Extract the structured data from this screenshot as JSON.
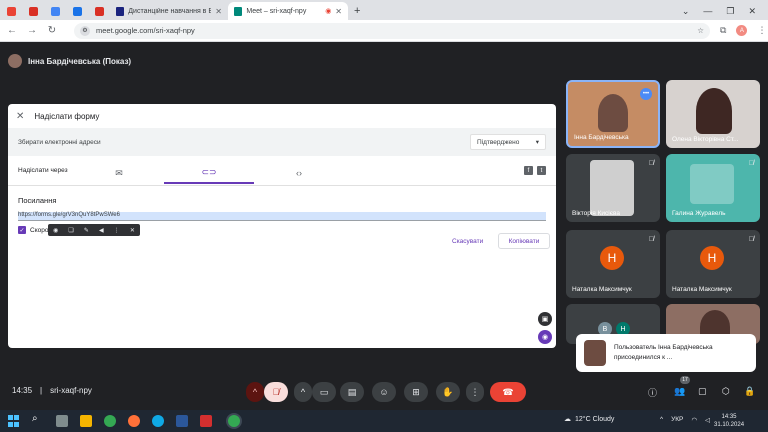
{
  "browser": {
    "tabs": [
      {
        "label": "",
        "icon": "gmail-icon",
        "color": "#ea4335"
      },
      {
        "label": "",
        "icon": "gmail-icon",
        "color": "#d93025"
      },
      {
        "label": "",
        "icon": "screen-icon",
        "color": "#4285f4"
      },
      {
        "label": "",
        "icon": "doc-icon",
        "color": "#1a73e8"
      },
      {
        "label": "",
        "icon": "form-icon",
        "color": "#d93025"
      },
      {
        "label": "Дистанційне навчання в ВСП",
        "icon": "vsp-icon",
        "color": "#1a237e"
      },
      {
        "label": "Meet – sri-xaqf-npy",
        "icon": "meet-icon",
        "color": "#00897b"
      }
    ],
    "url": "meet.google.com/sri-xaqf-npy",
    "profile_initial": "А"
  },
  "meet": {
    "presenter_label": "Інна Бардічевська (Показ)",
    "time": "14:35",
    "meeting_code": "sri-xaqf-npy",
    "participant_count": "17"
  },
  "dialog": {
    "title": "Надіслати форму",
    "collect_label": "Збирати електронні адреси",
    "collect_value": "Підтверджено",
    "send_via": "Надіслати через",
    "link_heading": "Посилання",
    "link_url": "https://forms.gle/grV3nQuY8tPwSWe6",
    "shorten_label": "Скорот",
    "cancel": "Скасувати",
    "copy": "Копіювати"
  },
  "participants": [
    {
      "name": "Інна Бардічевська"
    },
    {
      "name": "Олена Вікторівна Ст..."
    },
    {
      "name": "Вікторія Кисієва"
    },
    {
      "name": "Галина Журавель"
    },
    {
      "name": "Наталка Максимчук",
      "initial": "Н"
    },
    {
      "name": "Наталка Максимчук",
      "initial": "Н"
    },
    {
      "initials": [
        "В",
        "Н"
      ]
    }
  ],
  "toast": {
    "text": "Пользователь Інна Бардічевська присоединился к ..."
  },
  "taskbar": {
    "weather": "12°C  Cloudy",
    "lang": "УКР",
    "time": "14:35",
    "date": "31.10.2024"
  }
}
